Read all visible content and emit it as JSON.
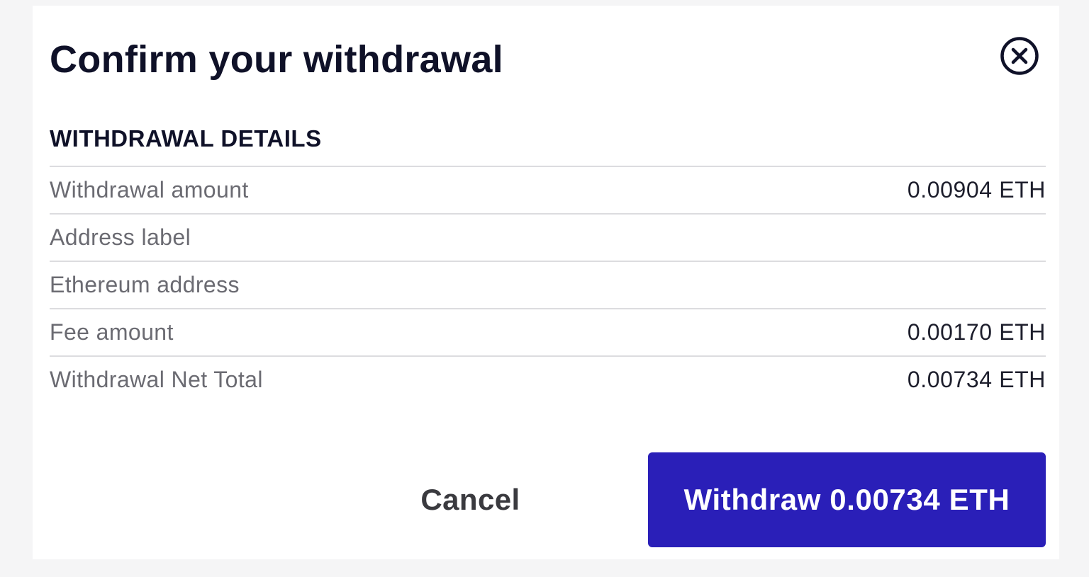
{
  "modal": {
    "title": "Confirm your withdrawal",
    "close_icon": "close-circle-icon"
  },
  "details": {
    "heading": "WITHDRAWAL DETAILS",
    "rows": [
      {
        "label": "Withdrawal amount",
        "value": "0.00904 ETH"
      },
      {
        "label": "Address label",
        "value": ""
      },
      {
        "label": "Ethereum address",
        "value": ""
      },
      {
        "label": "Fee amount",
        "value": "0.00170 ETH"
      },
      {
        "label": "Withdrawal Net Total",
        "value": "0.00734 ETH"
      }
    ]
  },
  "actions": {
    "cancel_label": "Cancel",
    "withdraw_label": "Withdraw 0.00734 ETH"
  },
  "colors": {
    "primary_button": "#2a1fb8",
    "title_text": "#0f1128",
    "label_text": "#6b6b72",
    "background": "#f5f5f6"
  }
}
